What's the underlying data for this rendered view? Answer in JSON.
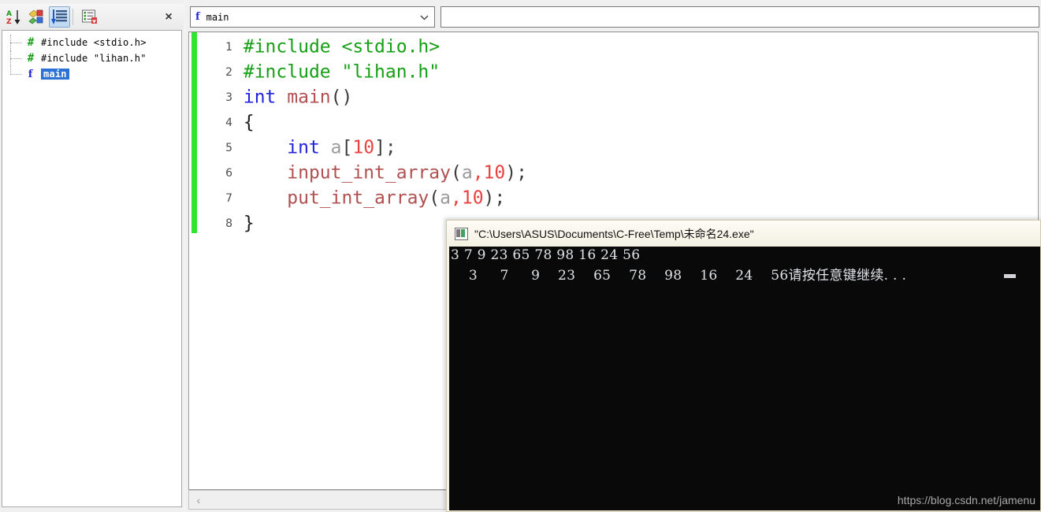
{
  "symbol_panel": {
    "toolbar": {
      "buttons": [
        {
          "name": "sort-alphabetical-icon",
          "title": "Sort alphabetically",
          "active": false
        },
        {
          "name": "sort-by-type-icon",
          "title": "Group by type",
          "active": false
        },
        {
          "name": "outline-view-icon",
          "title": "Outline view",
          "active": true
        },
        {
          "name": "symbol-list-icon",
          "title": "Symbol list",
          "active": false
        }
      ],
      "close_label": "×"
    },
    "tree": [
      {
        "icon": "hash-include-icon",
        "label": "#include <stdio.h>",
        "selected": false
      },
      {
        "icon": "hash-include-icon",
        "label": "#include \"lihan.h\"",
        "selected": false
      },
      {
        "icon": "function-icon",
        "label": "main",
        "selected": true
      }
    ]
  },
  "editor": {
    "scope_combo": {
      "icon": "function-icon",
      "value": "main",
      "arrow": "⌄"
    },
    "member_combo": {
      "value": "",
      "placeholder": ""
    },
    "scrollbar": {
      "left_arrow": "‹"
    },
    "lines": [
      {
        "num": "1",
        "tokens": [
          {
            "t": "#include <stdio.h>",
            "c": "t-pre"
          }
        ]
      },
      {
        "num": "2",
        "tokens": [
          {
            "t": "#include \"lihan.h\"",
            "c": "t-pre"
          }
        ]
      },
      {
        "num": "3",
        "tokens": [
          {
            "t": "int",
            "c": "t-key"
          },
          {
            "t": " ",
            "c": "t-plain"
          },
          {
            "t": "main",
            "c": "t-fn"
          },
          {
            "t": "()",
            "c": "t-pun"
          }
        ]
      },
      {
        "num": "4",
        "tokens": [
          {
            "t": "{",
            "c": "t-plain"
          }
        ]
      },
      {
        "num": "5",
        "tokens": [
          {
            "t": "    ",
            "c": "t-plain"
          },
          {
            "t": "int",
            "c": "t-key"
          },
          {
            "t": " ",
            "c": "t-plain"
          },
          {
            "t": "a",
            "c": "t-var"
          },
          {
            "t": "[",
            "c": "t-pun"
          },
          {
            "t": "10",
            "c": "t-num"
          },
          {
            "t": "];",
            "c": "t-pun"
          }
        ]
      },
      {
        "num": "6",
        "tokens": [
          {
            "t": "    ",
            "c": "t-plain"
          },
          {
            "t": "input_int_array",
            "c": "t-fn"
          },
          {
            "t": "(",
            "c": "t-pun"
          },
          {
            "t": "a",
            "c": "t-var"
          },
          {
            "t": ",",
            "c": "t-num"
          },
          {
            "t": "10",
            "c": "t-num"
          },
          {
            "t": ");",
            "c": "t-pun"
          }
        ]
      },
      {
        "num": "7",
        "tokens": [
          {
            "t": "    ",
            "c": "t-plain"
          },
          {
            "t": "put_int_array",
            "c": "t-fn"
          },
          {
            "t": "(",
            "c": "t-pun"
          },
          {
            "t": "a",
            "c": "t-var"
          },
          {
            "t": ",",
            "c": "t-num"
          },
          {
            "t": "10",
            "c": "t-num"
          },
          {
            "t": ");",
            "c": "t-pun"
          }
        ]
      },
      {
        "num": "8",
        "tokens": [
          {
            "t": "}",
            "c": "t-plain"
          }
        ]
      }
    ]
  },
  "console": {
    "icon": "console-window-icon",
    "title": "\"C:\\Users\\ASUS\\Documents\\C-Free\\Temp\\未命名24.exe\"",
    "output_line_1": "3 7 9 23 65 78 98 16 24 56",
    "output_line_2": "    3     7     9    23    65    78    98    16    24    56请按任意键继续. . .",
    "cursor": "_"
  },
  "watermark": "https://blog.csdn.net/jamenu",
  "colors": {
    "change_bar": "#31e431",
    "selection": "#2a72d4",
    "console_bg": "#090909",
    "preprocessor": "#16a016",
    "keyword": "#2222dd",
    "number": "#e8413f",
    "function": "#b05050"
  }
}
